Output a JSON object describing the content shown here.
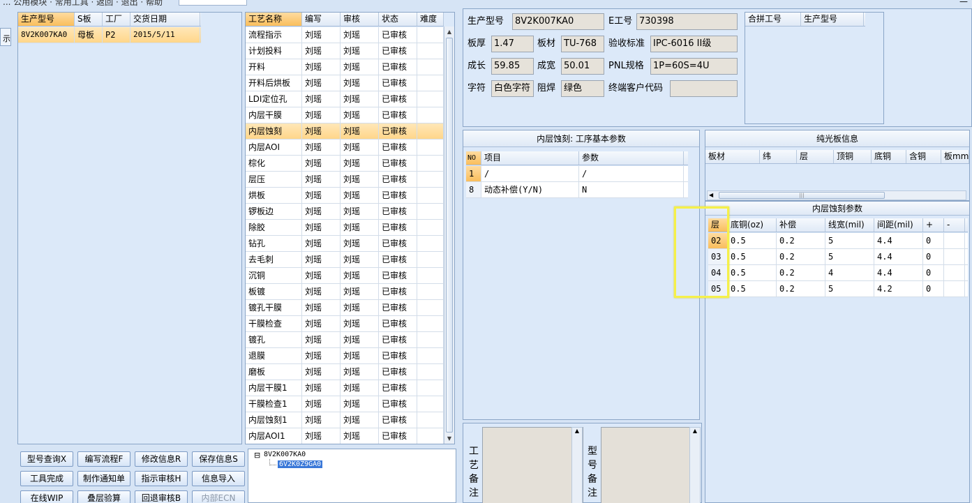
{
  "topbar": {
    "menu_text": "... 公用模块 · 常用工具 · 返回 · 退出 · 帮助",
    "close_glyph": "—",
    "left_tab_label": "示"
  },
  "order_grid": {
    "headers": [
      "生产型号",
      "S板",
      "工厂",
      "交货日期"
    ],
    "rows": [
      [
        "8V2K007KA0",
        "母板",
        "P2",
        "2015/5/11"
      ]
    ]
  },
  "process_grid": {
    "headers": [
      "工艺名称",
      "编写",
      "审核",
      "状态",
      "难度"
    ],
    "selected_index": 6,
    "rows": [
      [
        "流程指示",
        "刘瑶",
        "刘瑶",
        "已审核"
      ],
      [
        "计划投料",
        "刘瑶",
        "刘瑶",
        "已审核"
      ],
      [
        "开料",
        "刘瑶",
        "刘瑶",
        "已审核"
      ],
      [
        "开料后烘板",
        "刘瑶",
        "刘瑶",
        "已审核"
      ],
      [
        "LDI定位孔",
        "刘瑶",
        "刘瑶",
        "已审核"
      ],
      [
        "内层干膜",
        "刘瑶",
        "刘瑶",
        "已审核"
      ],
      [
        "内层蚀刻",
        "刘瑶",
        "刘瑶",
        "已审核"
      ],
      [
        "内层AOI",
        "刘瑶",
        "刘瑶",
        "已审核"
      ],
      [
        "棕化",
        "刘瑶",
        "刘瑶",
        "已审核"
      ],
      [
        "层压",
        "刘瑶",
        "刘瑶",
        "已审核"
      ],
      [
        "烘板",
        "刘瑶",
        "刘瑶",
        "已审核"
      ],
      [
        "锣板边",
        "刘瑶",
        "刘瑶",
        "已审核"
      ],
      [
        "除胶",
        "刘瑶",
        "刘瑶",
        "已审核"
      ],
      [
        "钻孔",
        "刘瑶",
        "刘瑶",
        "已审核"
      ],
      [
        "去毛刺",
        "刘瑶",
        "刘瑶",
        "已审核"
      ],
      [
        "沉铜",
        "刘瑶",
        "刘瑶",
        "已审核"
      ],
      [
        "板镀",
        "刘瑶",
        "刘瑶",
        "已审核"
      ],
      [
        "镀孔干膜",
        "刘瑶",
        "刘瑶",
        "已审核"
      ],
      [
        "干膜检查",
        "刘瑶",
        "刘瑶",
        "已审核"
      ],
      [
        "镀孔",
        "刘瑶",
        "刘瑶",
        "已审核"
      ],
      [
        "退膜",
        "刘瑶",
        "刘瑶",
        "已审核"
      ],
      [
        "磨板",
        "刘瑶",
        "刘瑶",
        "已审核"
      ],
      [
        "内层干膜1",
        "刘瑶",
        "刘瑶",
        "已审核"
      ],
      [
        "干膜检查1",
        "刘瑶",
        "刘瑶",
        "已审核"
      ],
      [
        "内层蚀刻1",
        "刘瑶",
        "刘瑶",
        "已审核"
      ],
      [
        "内层AOI1",
        "刘瑶",
        "刘瑶",
        "已审核"
      ]
    ]
  },
  "buttons": {
    "row1": [
      "型号查询X",
      "编写流程F",
      "修改信息R",
      "保存信息S"
    ],
    "row2": [
      "工具完成",
      "制作通知单",
      "指示审核H",
      "信息导入"
    ],
    "row3": [
      "在线WIP",
      "叠层验算",
      "回退审核B",
      "内部ECN"
    ]
  },
  "tree": {
    "root": "8V2K007KA0",
    "child": "6V2K0Z9GA0",
    "expander": "⊟"
  },
  "info": {
    "model_label": "生产型号",
    "model_value": "8V2K007KA0",
    "eno_label": "E工号",
    "eno_value": "730398",
    "thick_label": "板厚",
    "thick_value": "1.47",
    "material_label": "板材",
    "material_value": "TU-768",
    "std_label": "验收标准",
    "std_value": "IPC-6016 II级",
    "len_label": "成长",
    "len_value": "59.85",
    "wid_label": "成宽",
    "wid_value": "50.01",
    "pnl_label": "PNL规格",
    "pnl_value": "1P=60S=4U",
    "char_label": "字符",
    "char_value": "白色字符",
    "mask_label": "阻焊",
    "mask_value": "绿色",
    "cust_label": "终端客户代码",
    "cust_value": ""
  },
  "combine_grid": {
    "headers": [
      "合拼工号",
      "生产型号"
    ]
  },
  "etch_params": {
    "caption": "内层蚀刻: 工序基本参数",
    "headers": [
      "NO",
      "项目",
      "参数"
    ],
    "rows": [
      [
        "1",
        "/",
        "/"
      ],
      [
        "8",
        "动态补偿(Y/N)",
        "N"
      ]
    ]
  },
  "plain_board": {
    "caption": "纯光板信息",
    "headers": [
      "板材",
      "纬",
      "层",
      "顶铜",
      "底铜",
      "含铜",
      "板mm"
    ],
    "scroll_grip": "|||"
  },
  "layer_params": {
    "caption": "内层蚀刻参数",
    "headers": [
      "层",
      "底铜(oz)",
      "补偿",
      "线宽(mil)",
      "间距(mil)",
      "+",
      "-"
    ],
    "rows": [
      [
        "02",
        "0.5",
        "0.2",
        "5",
        "4.4",
        "0",
        ""
      ],
      [
        "03",
        "0.5",
        "0.2",
        "5",
        "4.4",
        "0",
        ""
      ],
      [
        "04",
        "0.5",
        "0.2",
        "4",
        "4.4",
        "0",
        ""
      ],
      [
        "05",
        "0.5",
        "0.2",
        "5",
        "4.2",
        "0",
        ""
      ]
    ]
  },
  "memo": {
    "process_label": [
      "工",
      "艺",
      "备",
      "注"
    ],
    "model_label": [
      "型",
      "号",
      "备",
      "注"
    ]
  },
  "colors": {
    "selection": "#ffd68a",
    "highlight_box": "#f5f04a",
    "panel_bg": "#dce9f9"
  }
}
